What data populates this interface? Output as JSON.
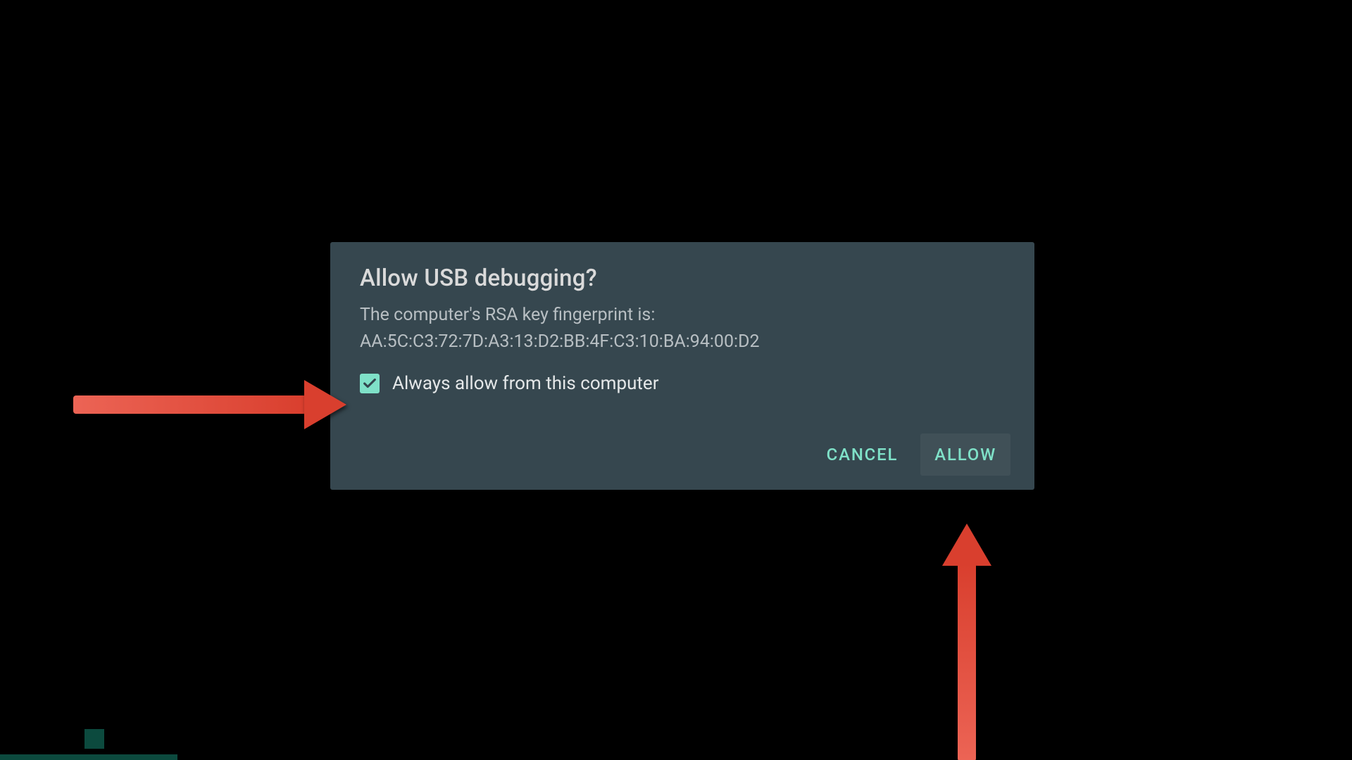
{
  "dialog": {
    "title": "Allow USB debugging?",
    "subtitle": "The computer's RSA key fingerprint is:",
    "fingerprint": "AA:5C:C3:72:7D:A3:13:D2:BB:4F:C3:10:BA:94:00:D2",
    "checkbox_label": "Always allow from this computer",
    "checkbox_checked": true,
    "cancel_label": "CANCEL",
    "allow_label": "ALLOW"
  },
  "annotations": {
    "arrow1_target": "always-allow-checkbox",
    "arrow2_target": "allow-button",
    "arrow_color": "#E04C3B"
  }
}
